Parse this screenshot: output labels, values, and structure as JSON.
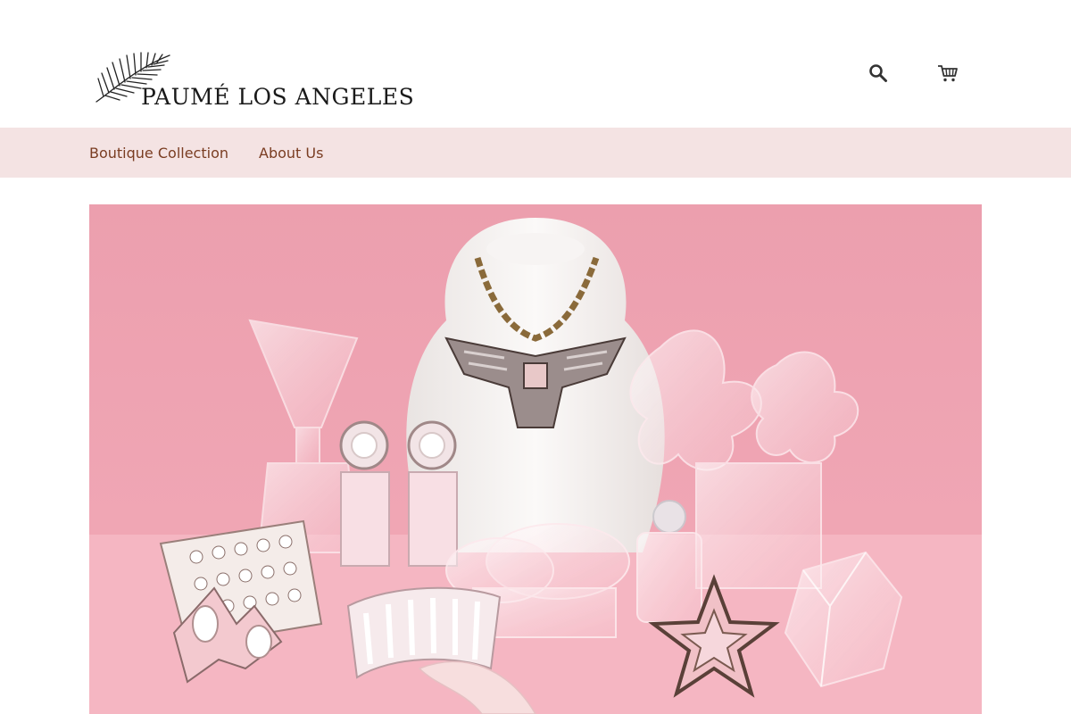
{
  "header": {
    "logo_text": "PAUMÉ LOS ANGELES",
    "icons": {
      "search": "search-icon",
      "cart": "cart-icon"
    }
  },
  "nav": {
    "items": [
      {
        "label": "Boutique Collection"
      },
      {
        "label": "About Us"
      }
    ]
  },
  "colors": {
    "nav_background": "#f4e3e3",
    "nav_text": "#7a3d22",
    "hero_background": "#eea6b4",
    "hero_table": "#f5b3c0"
  }
}
